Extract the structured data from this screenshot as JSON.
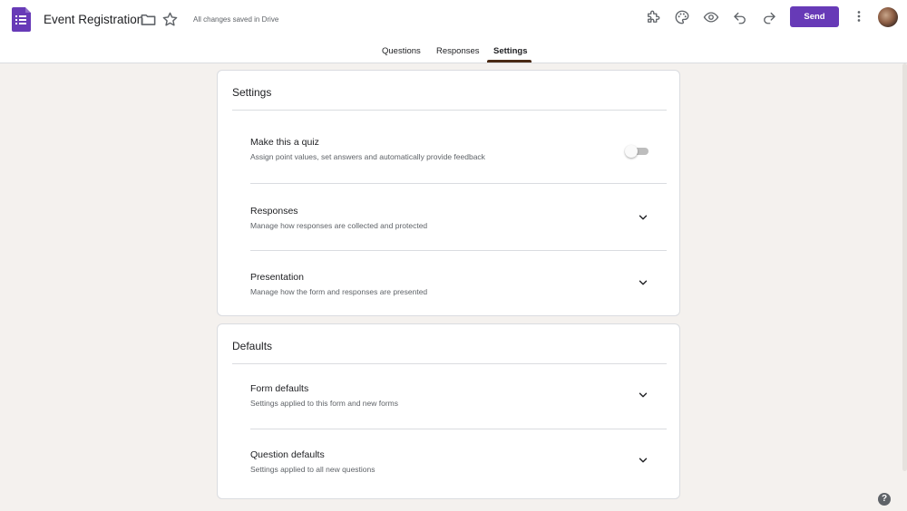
{
  "header": {
    "title": "Event Registration",
    "status": "All changes saved in Drive",
    "send_label": "Send",
    "icons": [
      "forms-logo-icon",
      "folder-icon",
      "star-icon",
      "puzzle-icon",
      "palette-icon",
      "eye-icon",
      "undo-icon",
      "redo-icon",
      "more-vert-icon",
      "avatar"
    ],
    "accent_color": "#673ab7"
  },
  "tabs": {
    "questions": "Questions",
    "responses": "Responses",
    "settings": "Settings",
    "active": "Settings"
  },
  "settings_card": {
    "title": "Settings",
    "quiz": {
      "title": "Make this a quiz",
      "description": "Assign point values, set answers and automatically provide feedback",
      "enabled": false
    },
    "responses": {
      "title": "Responses",
      "description": "Manage how responses are collected and protected"
    },
    "presentation": {
      "title": "Presentation",
      "description": "Manage how the form and responses are presented"
    }
  },
  "defaults_card": {
    "title": "Defaults",
    "form_defaults": {
      "title": "Form defaults",
      "description": "Settings applied to this form and new forms"
    },
    "question_defaults": {
      "title": "Question defaults",
      "description": "Settings applied to all new questions"
    }
  },
  "help": {
    "label": "?"
  }
}
